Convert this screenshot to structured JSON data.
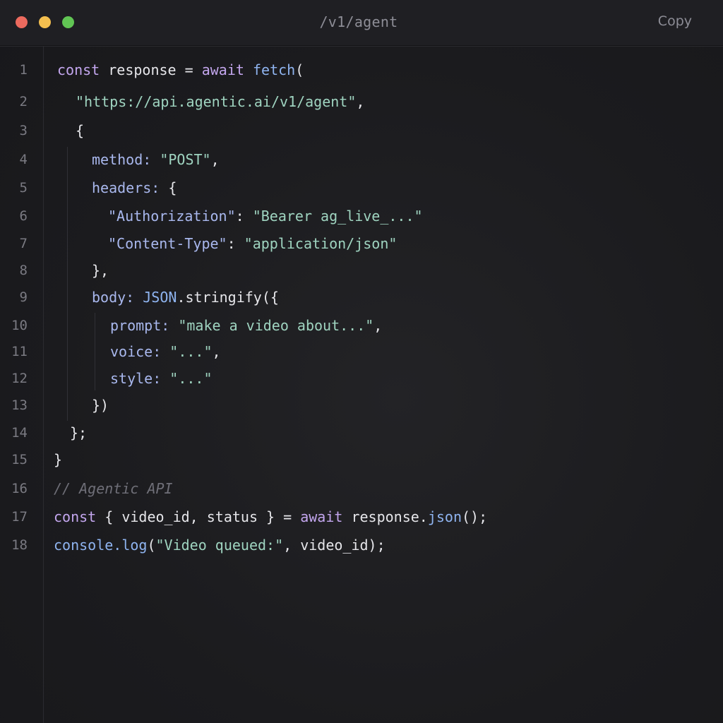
{
  "window": {
    "title": "/v1/agent",
    "copy_label": "Copy",
    "lights": [
      {
        "name": "close",
        "color": "#ec6a5e"
      },
      {
        "name": "minimize",
        "color": "#f4bf4f"
      },
      {
        "name": "zoom",
        "color": "#61c554"
      }
    ]
  },
  "colors": {
    "keyword": "#c3a6ee",
    "function": "#8fb4f0",
    "string": "#9fd4c0",
    "property": "#a9b8ee",
    "comment": "#6f6f78",
    "text": "#e6e6ea",
    "background": "#1c1c1f"
  },
  "code": {
    "lines": [
      {
        "number": "1",
        "tokens": [
          {
            "t": "kw",
            "v": "const"
          },
          {
            "t": "txt",
            "v": " response = "
          },
          {
            "t": "kw",
            "v": "await"
          },
          {
            "t": "txt",
            "v": " "
          },
          {
            "t": "fn",
            "v": "fetch"
          },
          {
            "t": "txt",
            "v": "("
          }
        ]
      },
      {
        "number": "2",
        "tokens": [
          {
            "t": "str",
            "v": "\"https://api.agentic.ai/v1/agent\""
          },
          {
            "t": "txt",
            "v": ","
          }
        ]
      },
      {
        "number": "3",
        "tokens": [
          {
            "t": "txt",
            "v": "{"
          }
        ]
      },
      {
        "number": "4",
        "tokens": [
          {
            "t": "key",
            "v": "method:"
          },
          {
            "t": "txt",
            "v": " "
          },
          {
            "t": "str",
            "v": "\"POST\""
          },
          {
            "t": "txt",
            "v": ","
          }
        ]
      },
      {
        "number": "5",
        "tokens": [
          {
            "t": "key",
            "v": "headers:"
          },
          {
            "t": "txt",
            "v": " {"
          }
        ]
      },
      {
        "number": "6",
        "tokens": [
          {
            "t": "key",
            "v": "\"Authorization\""
          },
          {
            "t": "txt",
            "v": ": "
          },
          {
            "t": "str",
            "v": "\"Bearer ag_live_...\""
          }
        ]
      },
      {
        "number": "7",
        "tokens": [
          {
            "t": "key",
            "v": "\"Content-Type\""
          },
          {
            "t": "txt",
            "v": ": "
          },
          {
            "t": "str",
            "v": "\"application/json\""
          }
        ]
      },
      {
        "number": "8",
        "tokens": [
          {
            "t": "txt",
            "v": "},"
          }
        ]
      },
      {
        "number": "9",
        "tokens": [
          {
            "t": "key",
            "v": "body:"
          },
          {
            "t": "txt",
            "v": " "
          },
          {
            "t": "fn",
            "v": "JSON"
          },
          {
            "t": "txt",
            "v": ".stringify({"
          }
        ]
      },
      {
        "number": "10",
        "tokens": [
          {
            "t": "key",
            "v": "prompt:"
          },
          {
            "t": "txt",
            "v": " "
          },
          {
            "t": "str",
            "v": "\"make a video about...\""
          },
          {
            "t": "txt",
            "v": ","
          }
        ]
      },
      {
        "number": "11",
        "tokens": [
          {
            "t": "key",
            "v": "voice:"
          },
          {
            "t": "txt",
            "v": " "
          },
          {
            "t": "str",
            "v": "\"...\""
          },
          {
            "t": "txt",
            "v": ","
          }
        ]
      },
      {
        "number": "12",
        "tokens": [
          {
            "t": "key",
            "v": "style:"
          },
          {
            "t": "txt",
            "v": " "
          },
          {
            "t": "str",
            "v": "\"...\""
          }
        ]
      },
      {
        "number": "13",
        "tokens": [
          {
            "t": "txt",
            "v": "})"
          }
        ]
      },
      {
        "number": "14",
        "tokens": [
          {
            "t": "txt",
            "v": "};"
          }
        ]
      },
      {
        "number": "15",
        "tokens": [
          {
            "t": "txt",
            "v": "}"
          }
        ]
      },
      {
        "number": "16",
        "tokens": [
          {
            "t": "cmt",
            "v": "// Agentic API"
          }
        ]
      },
      {
        "number": "17",
        "tokens": [
          {
            "t": "kw",
            "v": "const"
          },
          {
            "t": "txt",
            "v": " { video_id, status } = "
          },
          {
            "t": "kw",
            "v": "await"
          },
          {
            "t": "txt",
            "v": " response."
          },
          {
            "t": "fn",
            "v": "json"
          },
          {
            "t": "txt",
            "v": "();"
          }
        ]
      },
      {
        "number": "18",
        "tokens": [
          {
            "t": "fn",
            "v": "console.log"
          },
          {
            "t": "txt",
            "v": "("
          },
          {
            "t": "str",
            "v": "\"Video queued:\""
          },
          {
            "t": "txt",
            "v": ", video_id);"
          }
        ]
      }
    ]
  }
}
